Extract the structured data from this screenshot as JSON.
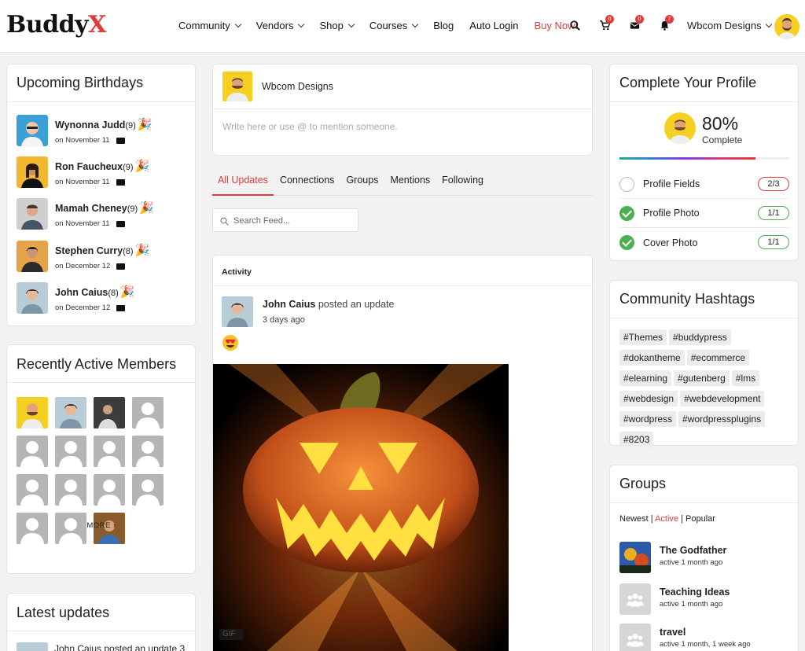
{
  "brand": {
    "logo_main": "Buddy",
    "logo_accent": "X"
  },
  "nav": {
    "items": [
      "Community",
      "Vendors",
      "Shop",
      "Courses",
      "Blog",
      "Auto Login",
      "Buy Now!"
    ],
    "cart_count": "0",
    "messages_count": "0",
    "notifications_count": "7",
    "user_name": "Wbcom Designs"
  },
  "birthdays": {
    "title": "Upcoming Birthdays",
    "people": [
      {
        "name": "Wynonna Judd",
        "age": "(9)",
        "date": "on November 11"
      },
      {
        "name": "Ron Faucheux",
        "age": "(9)",
        "date": "on November 11"
      },
      {
        "name": "Mamah Cheney",
        "age": "(9)",
        "date": "on November 11"
      },
      {
        "name": "Stephen Curry",
        "age": "(8)",
        "date": "on December 12"
      },
      {
        "name": "John Caius",
        "age": "(8)",
        "date": "on December 12"
      }
    ]
  },
  "recent_members": {
    "title": "Recently Active Members",
    "more": "MORE"
  },
  "latest_updates": {
    "title": "Latest updates",
    "first_item": "John Caius posted an update 3"
  },
  "composer": {
    "user": "Wbcom Designs",
    "placeholder": "Write here or use @ to mention someone."
  },
  "tabs": [
    "All Updates",
    "Connections",
    "Groups",
    "Mentions",
    "Following"
  ],
  "search": {
    "placeholder": "Search Feed..."
  },
  "activity": {
    "header": "Activity",
    "author": "John Caius",
    "action": " posted an update",
    "time": "3 days ago",
    "gif_label": "GIF"
  },
  "profile": {
    "title": "Complete Your Profile",
    "percent": "80%",
    "percent_label": "Complete",
    "progress": 0.8,
    "rows": [
      {
        "label": "Profile Fields",
        "count": "2/3",
        "done": false
      },
      {
        "label": "Profile Photo",
        "count": "1/1",
        "done": true
      },
      {
        "label": "Cover Photo",
        "count": "1/1",
        "done": true
      }
    ]
  },
  "hashtags": {
    "title": "Community Hashtags",
    "tags": [
      "#Themes",
      "#buddypress",
      "#dokantheme",
      "#ecommerce",
      "#elearning",
      "#gutenberg",
      "#lms",
      "#webdesign",
      "#webdevelopment",
      "#wordpress",
      "#wordpressplugins",
      "#8203"
    ]
  },
  "groups": {
    "title": "Groups",
    "filter_newest": "Newest",
    "filter_active": "Active",
    "filter_popular": "Popular",
    "sep": " | ",
    "items": [
      {
        "name": "The Godfather",
        "activity": "active 1 month ago"
      },
      {
        "name": "Teaching Ideas",
        "activity": "active 1 month ago"
      },
      {
        "name": "travel",
        "activity": "active 1 month, 1 week ago"
      }
    ]
  },
  "colors": {
    "accent": "#e23b3b",
    "success": "#4caf50"
  }
}
